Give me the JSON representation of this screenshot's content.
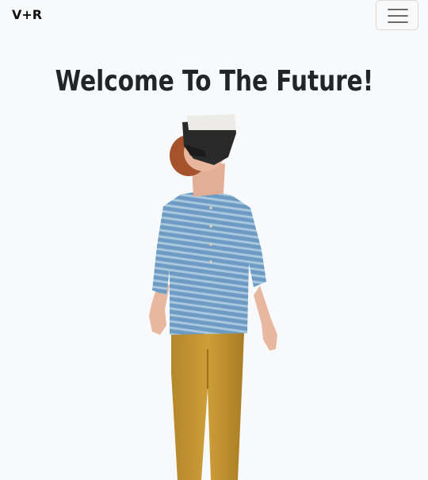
{
  "navbar": {
    "brand": "V+R",
    "toggle_icon": "hamburger-menu-icon"
  },
  "hero": {
    "title": "Welcome To The Future!",
    "image_description_icon": "vr-headset-boy-illustration"
  },
  "colors": {
    "background": "#f8f9fa",
    "title": "#212529",
    "shirt": "#6d9cc4",
    "pants": "#c29631",
    "headset": "#2b2b2b"
  }
}
